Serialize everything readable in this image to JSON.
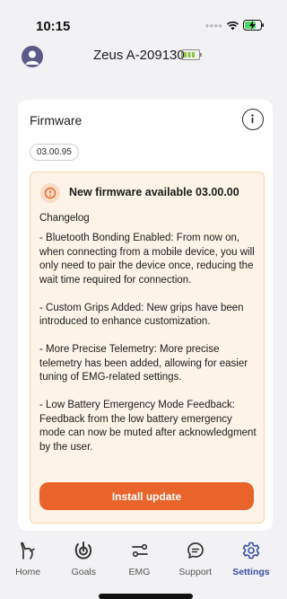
{
  "status_bar": {
    "time": "10:15",
    "icons": [
      "signal-dots-icon",
      "wifi-icon",
      "battery-charging-icon"
    ]
  },
  "device": {
    "name": "Zeus A-209130",
    "avatar_icon": "user-avatar-icon",
    "battery_icon": "battery-high-icon"
  },
  "firmware": {
    "title": "Firmware",
    "info_icon": "info-icon",
    "current_version": "03.00.95",
    "update": {
      "title": "New firmware available 03.00.00",
      "changelog_label": "Changelog",
      "changelog": [
        "- Bluetooth Bonding Enabled: From now on, when connecting from a mobile device, you will only need to pair the device once, reducing the wait time required for connection.",
        "- Custom Grips Added: New grips have been introduced to enhance customization.",
        "- More Precise Telemetry: More precise telemetry has been added, allowing for easier tuning of EMG-related settings.",
        "- Low Battery Emergency Mode Feedback: Feedback from the low battery emergency mode can now be muted after acknowledgment by the user."
      ],
      "install_label": "Install update"
    }
  },
  "tabs": [
    {
      "label": "Home",
      "icon": "hand-icon",
      "active": false
    },
    {
      "label": "Goals",
      "icon": "goals-icon",
      "active": false
    },
    {
      "label": "EMG",
      "icon": "emg-icon",
      "active": false
    },
    {
      "label": "Support",
      "icon": "chat-icon",
      "active": false
    },
    {
      "label": "Settings",
      "icon": "gear-icon",
      "active": true
    }
  ],
  "colors": {
    "accent": "#e8642a",
    "active_tab": "#3b4fa3",
    "update_bg": "#fdf3e6",
    "update_border": "#f3d7b0",
    "battery_green": "#8cc63f"
  }
}
